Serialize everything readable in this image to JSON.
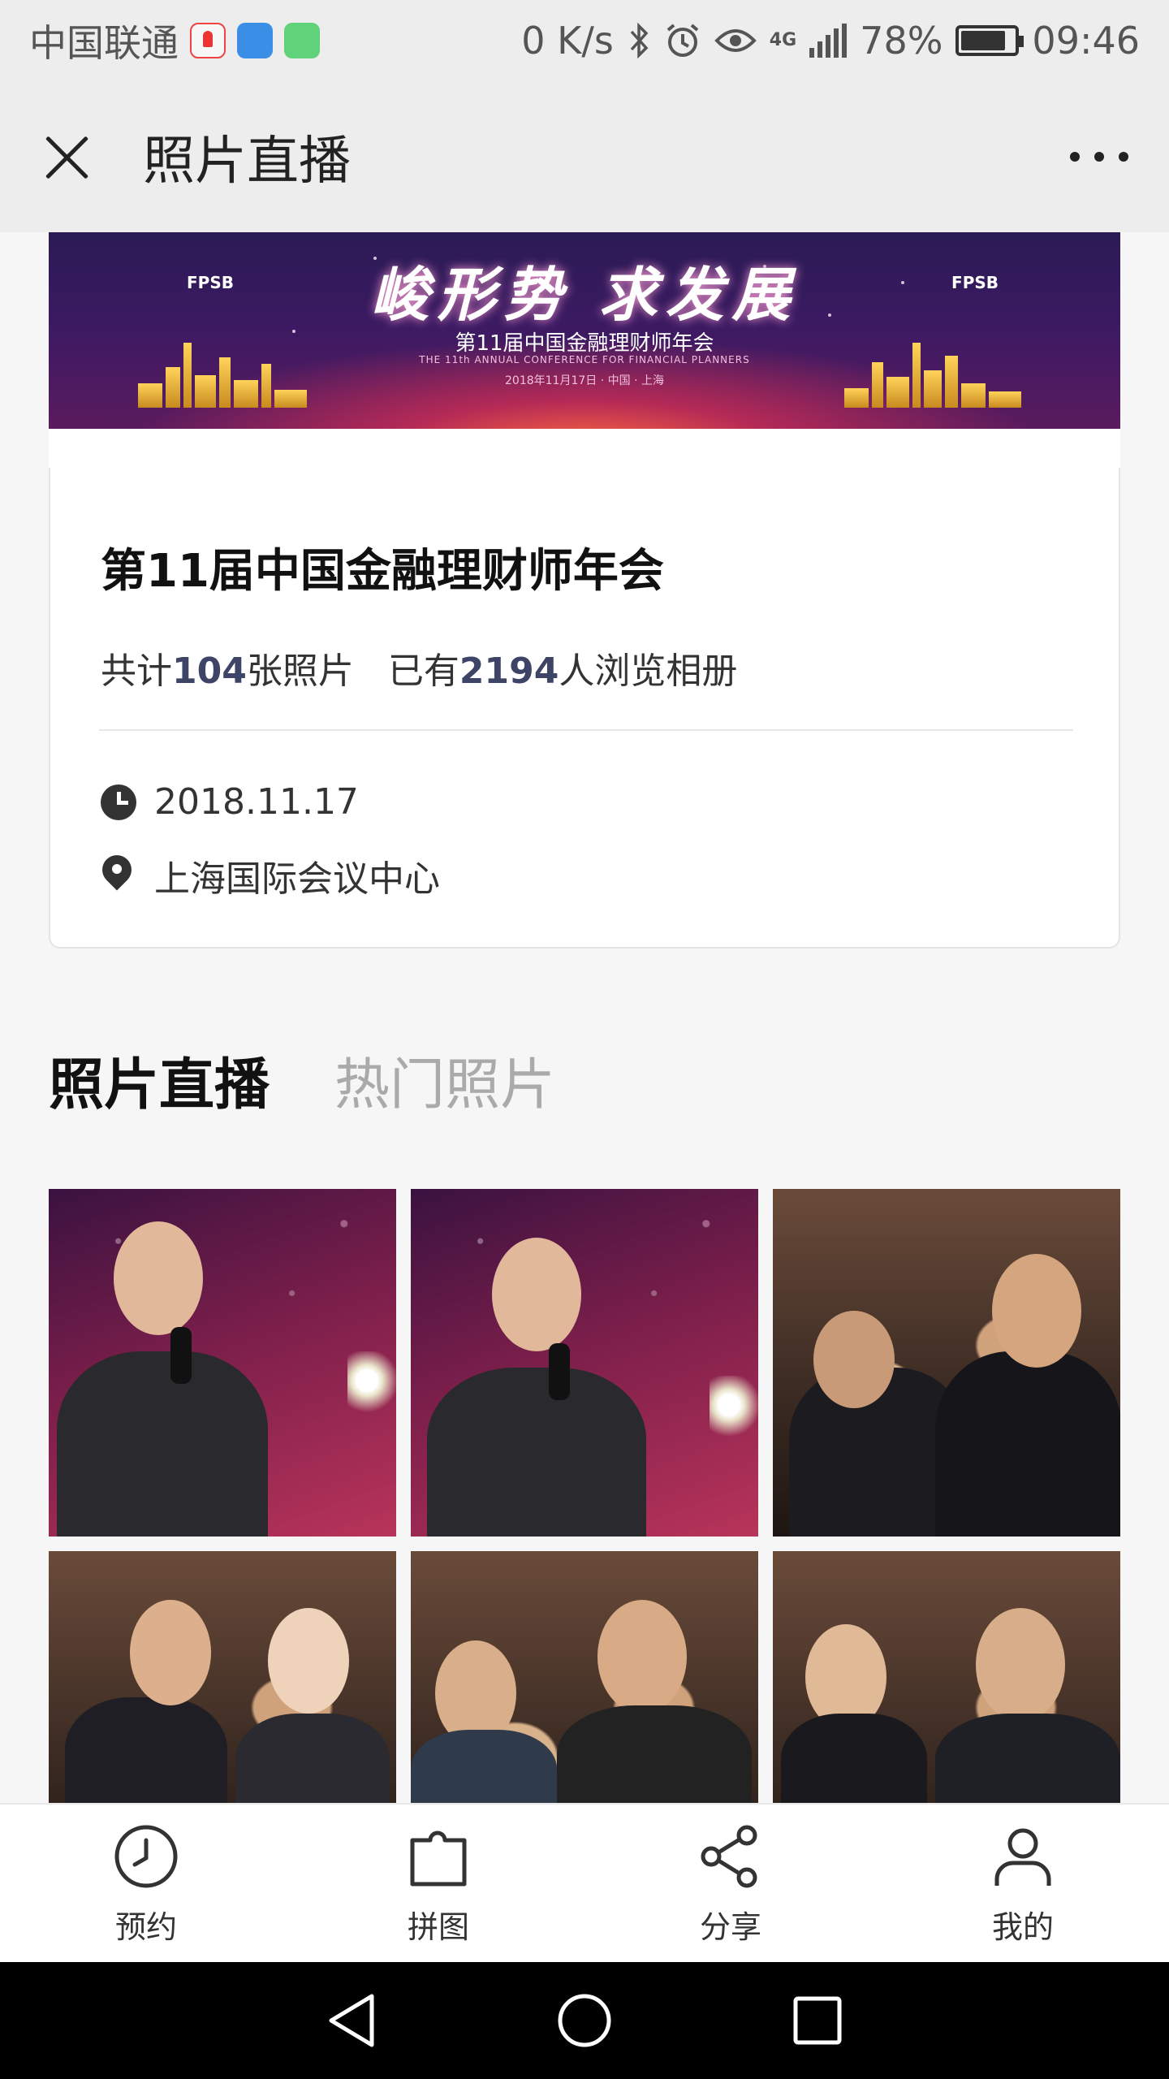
{
  "status_bar": {
    "carrier": "中国联通",
    "net_speed": "0 K/s",
    "network": "4G",
    "battery": "78%",
    "time": "09:46"
  },
  "nav": {
    "title": "照片直播"
  },
  "banner": {
    "slogan": "峻形势 求发展",
    "subtitle": "第11届中国金融理财师年会",
    "subtitle_en": "THE 11th ANNUAL CONFERENCE FOR FINANCIAL PLANNERS",
    "date_place": "2018年11月17日 · 中国 · 上海",
    "logo_text": "FPSB"
  },
  "event": {
    "title": "第11届中国金融理财师年会",
    "stats_prefix": "共计",
    "photo_count": "104",
    "stats_mid": "张照片",
    "viewers_prefix": "已有",
    "viewer_count": "2194",
    "viewers_suffix": "人浏览相册",
    "date": "2018.11.17",
    "location": "上海国际会议中心"
  },
  "tabs": [
    {
      "label": "照片直播",
      "active": true
    },
    {
      "label": "热门照片",
      "active": false
    }
  ],
  "bottom_nav": [
    {
      "label": "预约",
      "icon": "clock-icon"
    },
    {
      "label": "拼图",
      "icon": "puzzle-icon"
    },
    {
      "label": "分享",
      "icon": "share-icon"
    },
    {
      "label": "我的",
      "icon": "user-icon"
    }
  ],
  "colors": {
    "accent_number": "#3d4466",
    "tab_inactive": "#aaaaaa"
  }
}
